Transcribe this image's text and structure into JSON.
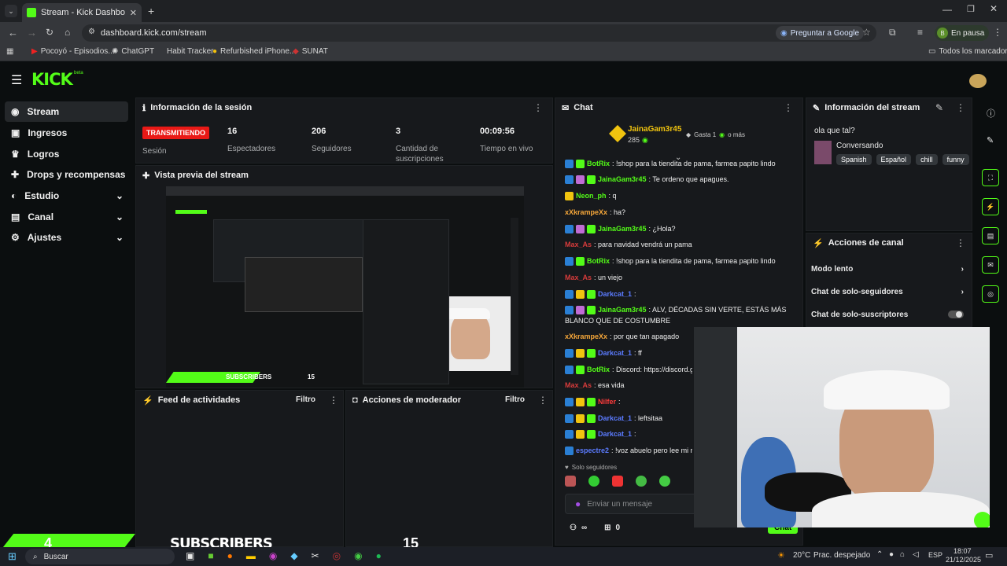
{
  "browser": {
    "tab_title": "Stream - Kick Dashboard",
    "url": "dashboard.kick.com/stream",
    "ask_google": "Preguntar a Google",
    "profile_status": "En pausa",
    "profile_initial": "B",
    "all_bookmarks": "Todos los marcadores",
    "bookmarks": [
      "Pocoyó - Episodios...",
      "ChatGPT",
      "Habit Tracker",
      "Refurbished iPhone...",
      "SUNAT"
    ]
  },
  "kick": {
    "logo": "KICK",
    "beta": "beta",
    "nav": [
      {
        "label": "Stream"
      },
      {
        "label": "Ingresos"
      },
      {
        "label": "Logros"
      },
      {
        "label": "Drops y recompensas"
      },
      {
        "label": "Estudio"
      },
      {
        "label": "Canal"
      },
      {
        "label": "Ajustes"
      }
    ],
    "session": {
      "title": "Información de la sesión",
      "status": "TRANSMITIENDO",
      "status_label": "Sesión",
      "stats": [
        {
          "value": "16",
          "label": "Espectadores"
        },
        {
          "value": "206",
          "label": "Seguidores"
        },
        {
          "value": "3",
          "label": "Cantidad de suscripciones"
        },
        {
          "value": "00:09:56",
          "label": "Tiempo en vivo"
        }
      ]
    },
    "preview": {
      "title": "Vista previa del stream"
    },
    "activity": {
      "title": "Feed de actividades",
      "filter": "Filtro"
    },
    "mod": {
      "title": "Acciones de moderador",
      "filter": "Filtro"
    },
    "chat": {
      "title": "Chat",
      "pinned_user": "JainaGam3r45",
      "pinned_amount": "285",
      "gift_label": "Gasta 1",
      "gift_more": "o más",
      "messages": [
        {
          "user": "BotRix",
          "text": ": !shop para la tiendita de pama, farmea papito lindo",
          "color": "#53fc18"
        },
        {
          "user": "JainaGam3r45",
          "text": ": Te ordeno que apagues.",
          "color": "#53fc18"
        },
        {
          "user": "Neon_ph",
          "text": ": q",
          "color": "#53fc18"
        },
        {
          "user": "xXkrampeXx",
          "text": ": ha?",
          "color": "#f7a83a"
        },
        {
          "user": "JainaGam3r45",
          "text": ": ¿Hola?",
          "color": "#53fc18"
        },
        {
          "user": "Max_As",
          "text": ": para navidad vendrá un pama",
          "color": "#d63b3b"
        },
        {
          "user": "BotRix",
          "text": ": !shop para la tiendita de pama, farmea papito lindo",
          "color": "#53fc18"
        },
        {
          "user": "Max_As",
          "text": ": un viejo",
          "color": "#d63b3b"
        },
        {
          "user": "Darkcat_1",
          "text": ":",
          "color": "#5b7bff"
        },
        {
          "user": "JainaGam3r45",
          "text": ": ALV, DÉCADAS SIN VERTE, ESTÁS MÁS",
          "color": "#53fc18"
        },
        {
          "user": "",
          "text": "BLANCO QUE DE COSTUMBRE",
          "color": "#ffffff"
        },
        {
          "user": "xXkrampeXx",
          "text": ": por que tan apagado",
          "color": "#f7a83a"
        },
        {
          "user": "Darkcat_1",
          "text": ": ff",
          "color": "#5b7bff"
        },
        {
          "user": "BotRix",
          "text": ": Discord: https://discord.g",
          "color": "#53fc18"
        },
        {
          "user": "Max_As",
          "text": ": esa vida",
          "color": "#d63b3b"
        },
        {
          "user": "Nilfer",
          "text": ":",
          "color": "#ff3b3b"
        },
        {
          "user": "Darkcat_1",
          "text": ": leftsitaa",
          "color": "#5b7bff"
        },
        {
          "user": "Darkcat_1",
          "text": ":",
          "color": "#5b7bff"
        },
        {
          "user": "espectre2",
          "text": ": !voz abuelo pero lee mi r",
          "color": "#5b7bff"
        }
      ],
      "followers_only": "Solo seguidores",
      "placeholder": "Enviar un mensaje",
      "count_infinity": "∞",
      "gift_count": "0",
      "send": "Chat"
    },
    "stream_info": {
      "title": "Información del stream",
      "stream_title": "ola que tal?",
      "category": "Conversando",
      "tags": [
        "Spanish",
        "Español",
        "chill",
        "funny"
      ]
    },
    "channel_actions": {
      "title": "Acciones de canal",
      "items": [
        "Modo lento",
        "Chat de solo-seguidores",
        "Chat de solo-suscriptores"
      ]
    }
  },
  "overlay": {
    "sub_count": "4",
    "sub_text": "SUBSCRIBERS",
    "sub_goal": "15"
  },
  "taskbar": {
    "search": "Buscar",
    "weather": "20°C",
    "weather_desc": "Prac. despejado",
    "lang": "ESP",
    "time": "18:07",
    "date": "21/12/2025"
  },
  "colors": {
    "accent": "#53fc18",
    "live": "#e91916"
  }
}
